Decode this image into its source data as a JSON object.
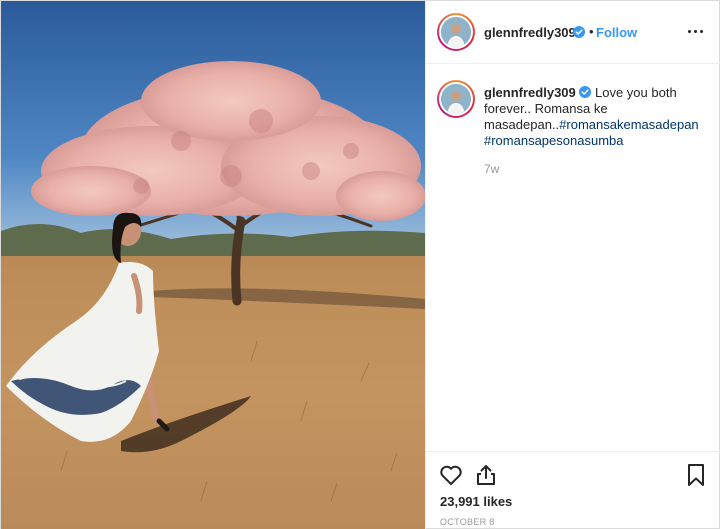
{
  "post": {
    "author": {
      "username": "glennfredly309",
      "verified": true,
      "follow_label": "Follow",
      "separator": "•"
    },
    "caption": {
      "username": "glennfredly309",
      "text": " Love you both forever.. Romansa ke masadepan..",
      "hashtags": [
        "#romansakemasadepan",
        "#romansapesonasumba"
      ]
    },
    "time_ago": "7w",
    "likes": "23,991 likes",
    "date": "OCTOBER 8",
    "icons": {
      "more": "more-options-icon",
      "verified": "verified-badge-icon",
      "like": "heart-icon",
      "share": "share-icon",
      "save": "bookmark-icon"
    },
    "colors": {
      "link": "#3897f0",
      "hashtag": "#003569",
      "muted": "#999999",
      "text": "#262626"
    }
  }
}
